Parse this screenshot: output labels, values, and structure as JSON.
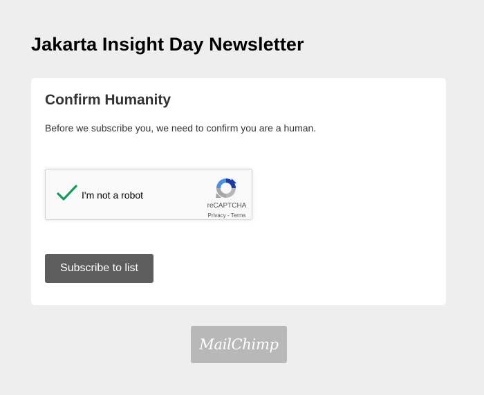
{
  "page": {
    "title": "Jakarta Insight Day Newsletter"
  },
  "card": {
    "heading": "Confirm Humanity",
    "description": "Before we subscribe you, we need to confirm you are a human."
  },
  "recaptcha": {
    "label": "I'm not a robot",
    "checked": true,
    "brand": "reCAPTCHA",
    "privacy_link": "Privacy",
    "separator": " - ",
    "terms_link": "Terms",
    "check_color": "#0f9d58",
    "icon": "recaptcha-logo-icon"
  },
  "actions": {
    "subscribe_label": "Subscribe to list"
  },
  "footer": {
    "badge_text": "MailChimp"
  },
  "colors": {
    "background": "#eeeeee",
    "card": "#ffffff",
    "button": "#5d5d5d",
    "badge": "#b8b8b8"
  }
}
